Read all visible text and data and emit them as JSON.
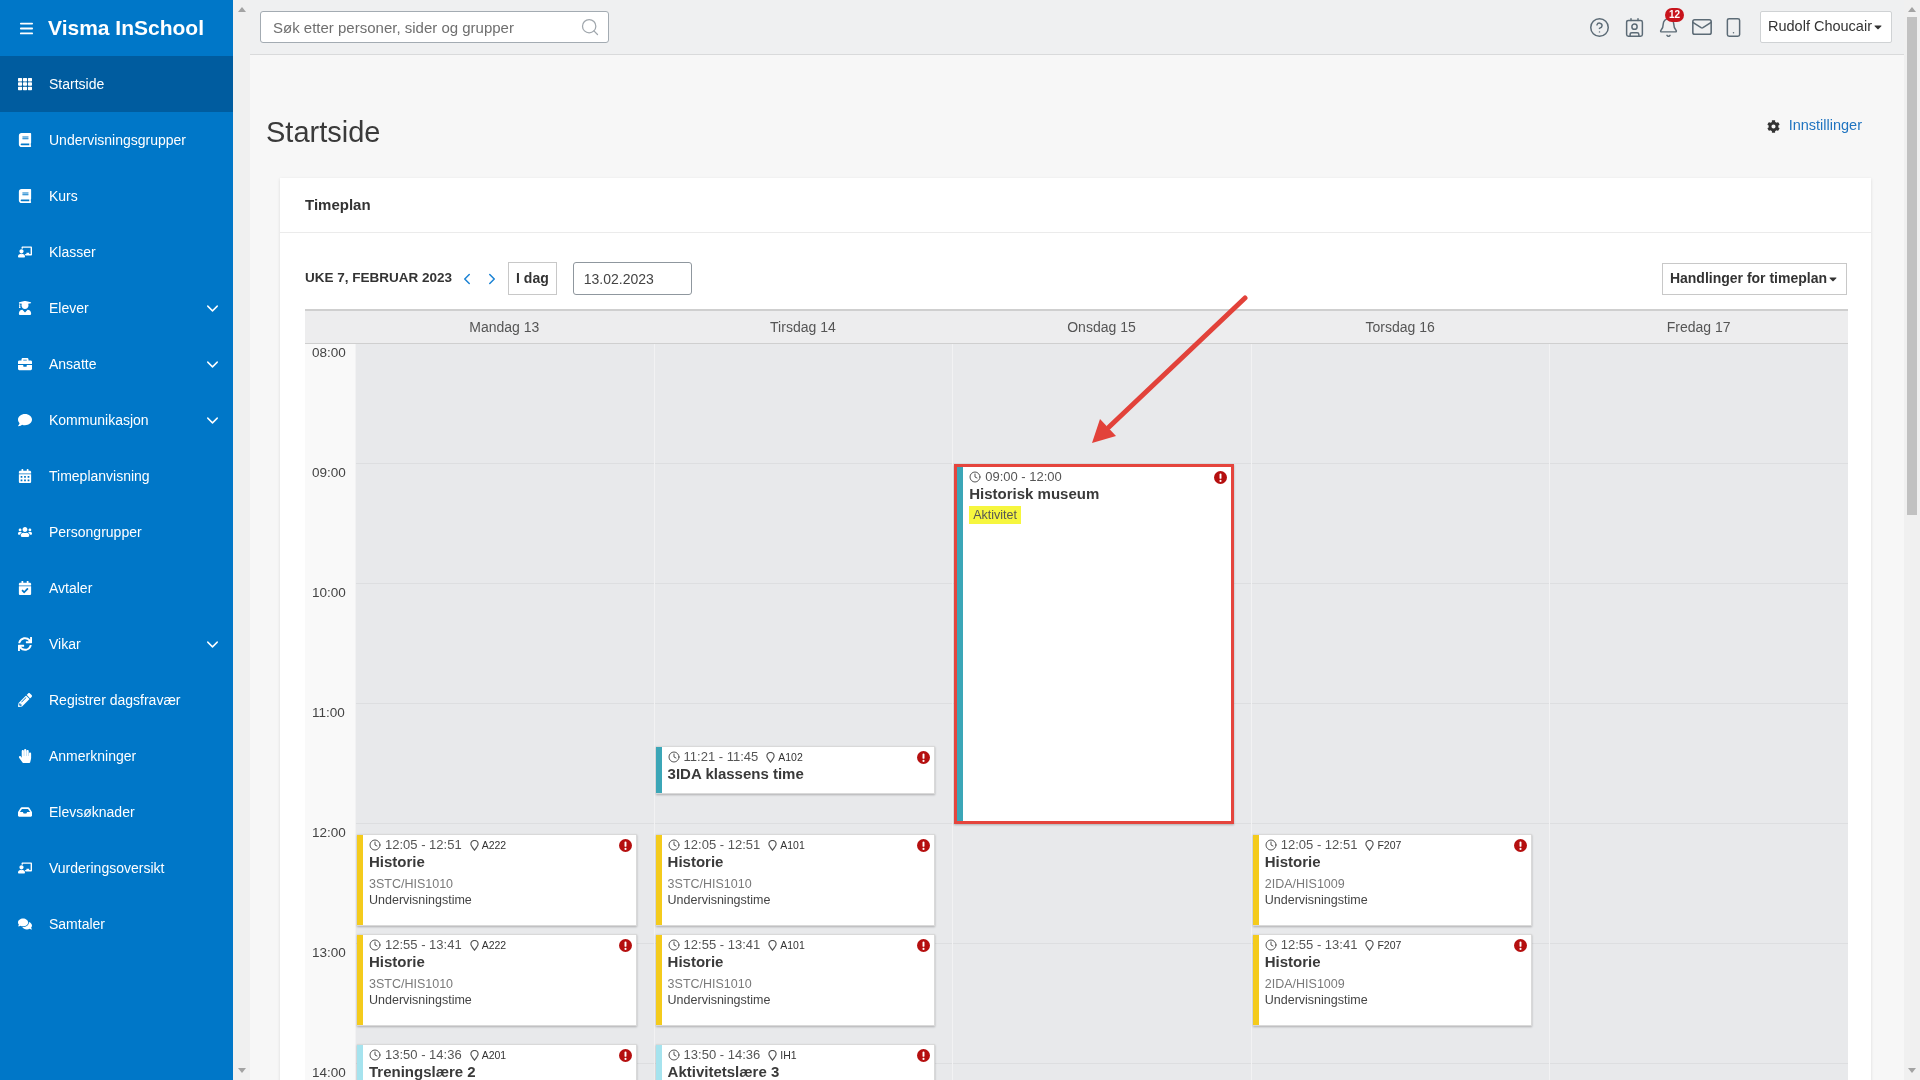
{
  "sidebar": {
    "title": "Visma InSchool",
    "items": [
      {
        "label": "Startside",
        "selected": true,
        "expandable": false
      },
      {
        "label": "Undervisningsgrupper",
        "selected": false,
        "expandable": false
      },
      {
        "label": "Kurs",
        "selected": false,
        "expandable": false
      },
      {
        "label": "Klasser",
        "selected": false,
        "expandable": false
      },
      {
        "label": "Elever",
        "selected": false,
        "expandable": true
      },
      {
        "label": "Ansatte",
        "selected": false,
        "expandable": true
      },
      {
        "label": "Kommunikasjon",
        "selected": false,
        "expandable": true
      },
      {
        "label": "Timeplanvisning",
        "selected": false,
        "expandable": false
      },
      {
        "label": "Persongrupper",
        "selected": false,
        "expandable": false
      },
      {
        "label": "Avtaler",
        "selected": false,
        "expandable": false
      },
      {
        "label": "Vikar",
        "selected": false,
        "expandable": true
      },
      {
        "label": "Registrer dagsfravær",
        "selected": false,
        "expandable": false
      },
      {
        "label": "Anmerkninger",
        "selected": false,
        "expandable": false
      },
      {
        "label": "Elevsøknader",
        "selected": false,
        "expandable": false
      },
      {
        "label": "Vurderingsoversikt",
        "selected": false,
        "expandable": false
      },
      {
        "label": "Samtaler",
        "selected": false,
        "expandable": false
      }
    ]
  },
  "top_bar": {
    "search": {
      "placeholder": "Søk etter personer, sider og grupper"
    },
    "notification_count": "12",
    "user_menu": "Rudolf Choucair"
  },
  "page": {
    "title": "Startside",
    "settings_link": "Innstillinger"
  },
  "timeplan": {
    "title": "Timeplan",
    "week_label": "UKE 7, FEBRUAR 2023",
    "today_button": "I dag",
    "date_field": {
      "value": "13.02.2023"
    },
    "actions_button": "Handlinger for timeplan",
    "hours": [
      "08:00",
      "09:00",
      "10:00",
      "11:00",
      "12:00",
      "13:00",
      "14:00"
    ],
    "days": [
      {
        "label": "Mandag 13",
        "events": [
          {
            "time": "12:05 - 12:51",
            "room": "A222",
            "title": "Historie",
            "group": "3STC/HIS1010",
            "type": "Undervisningstime",
            "color": "#f4cb1c",
            "alert": true,
            "highlighted": false
          },
          {
            "time": "12:55 - 13:41",
            "room": "A222",
            "title": "Historie",
            "group": "3STC/HIS1010",
            "type": "Undervisningstime",
            "color": "#f4cb1c",
            "alert": true,
            "highlighted": false
          },
          {
            "time": "13:50 - 14:36",
            "room": "A201",
            "title": "Treningslære 2",
            "color": "#a6e3ee",
            "alert": true,
            "highlighted": false
          }
        ]
      },
      {
        "label": "Tirsdag 14",
        "events": [
          {
            "time": "11:21 - 11:45",
            "room": "A102",
            "title": "3IDA klassens time",
            "color": "#3ba6b7",
            "alert": true,
            "highlighted": false
          },
          {
            "time": "12:05 - 12:51",
            "room": "A101",
            "title": "Historie",
            "group": "3STC/HIS1010",
            "type": "Undervisningstime",
            "color": "#f4cb1c",
            "alert": true,
            "highlighted": false
          },
          {
            "time": "12:55 - 13:41",
            "room": "A101",
            "title": "Historie",
            "group": "3STC/HIS1010",
            "type": "Undervisningstime",
            "color": "#f4cb1c",
            "alert": true,
            "highlighted": false
          },
          {
            "time": "13:50 - 14:36",
            "room": "IH1",
            "title": "Aktivitetslære 3",
            "color": "#a6e3ee",
            "alert": true,
            "highlighted": false
          }
        ]
      },
      {
        "label": "Onsdag 15",
        "events": [
          {
            "time": "09:00 - 12:00",
            "title": "Historisk museum",
            "tag": "Aktivitet",
            "color": "#3ba6b7",
            "alert": true,
            "highlighted": true
          }
        ]
      },
      {
        "label": "Torsdag 16",
        "events": [
          {
            "time": "12:05 - 12:51",
            "room": "F207",
            "title": "Historie",
            "group": "2IDA/HIS1009",
            "type": "Undervisningstime",
            "color": "#f4cb1c",
            "alert": true,
            "highlighted": false
          },
          {
            "time": "12:55 - 13:41",
            "room": "F207",
            "title": "Historie",
            "group": "2IDA/HIS1009",
            "type": "Undervisningstime",
            "color": "#f4cb1c",
            "alert": true,
            "highlighted": false
          }
        ]
      },
      {
        "label": "Fredag 17"
      }
    ]
  }
}
